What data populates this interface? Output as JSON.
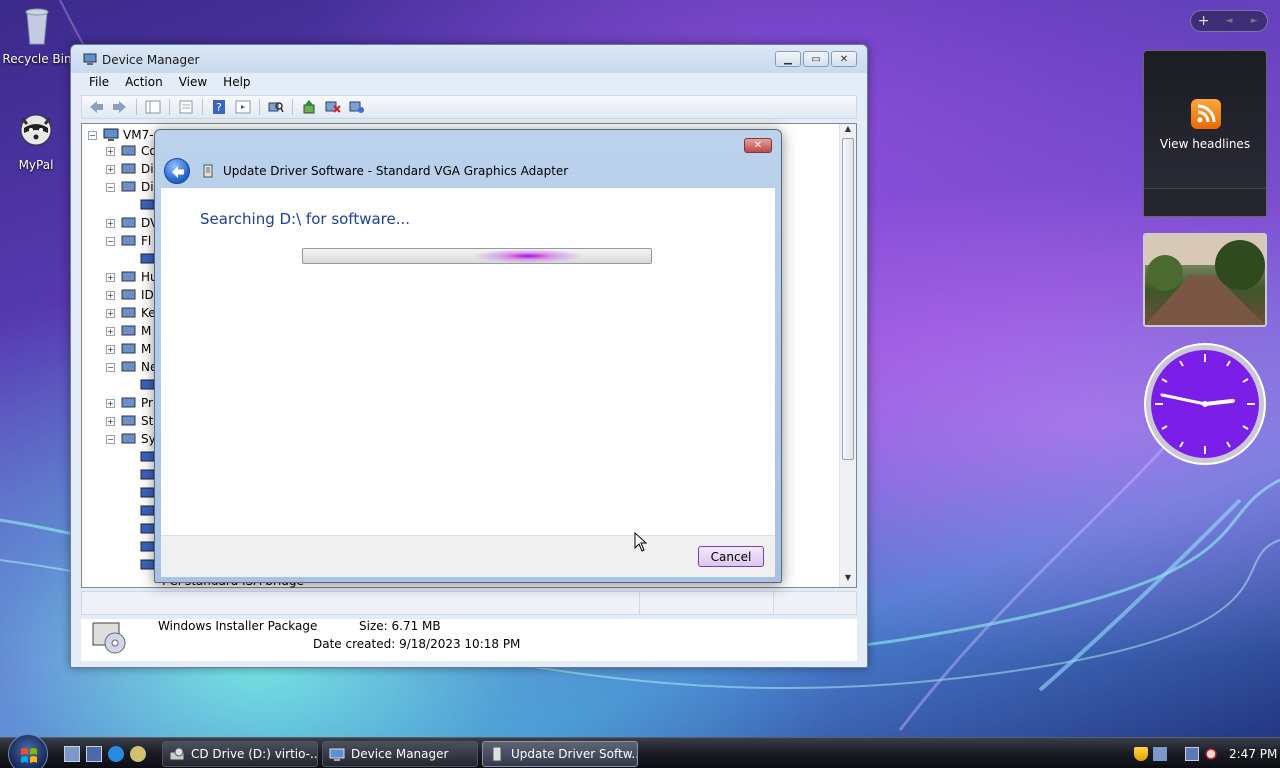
{
  "desktop": {
    "icons": [
      {
        "label": "Recycle Bin",
        "icon": "recycle-bin-icon"
      },
      {
        "label": "MyPal",
        "icon": "mypal-raccoon-icon"
      }
    ]
  },
  "gadgets": {
    "news_label": "View headlines",
    "sidebar_controls": [
      "+",
      "◄",
      "►"
    ],
    "clock": {
      "hour": 2,
      "minute": 47
    }
  },
  "device_manager": {
    "title": "Device Manager",
    "menu": [
      "File",
      "Action",
      "View",
      "Help"
    ],
    "tree_root": "VM7-",
    "tree_items": [
      "Co",
      "Di",
      "Di",
      "DV",
      "Fl",
      "Hu",
      "ID",
      "Ke",
      "M",
      "M",
      "Ne",
      "Pr",
      "St",
      "Sy"
    ],
    "tree_bottom_item": "PCI standard ISA bridge",
    "details": {
      "type": "Windows Installer Package",
      "size_label": "Size:",
      "size_value": "6.71 MB",
      "date_label": "Date created:",
      "date_value": "9/18/2023 10:18 PM"
    }
  },
  "dialog": {
    "title": "Update Driver Software - Standard VGA Graphics Adapter",
    "message": "Searching D:\\ for software...",
    "cancel_label": "Cancel",
    "close_glyph": "✕"
  },
  "taskbar": {
    "buttons": [
      {
        "label": "CD Drive (D:) virtio-...",
        "icon": "cd-drive-icon"
      },
      {
        "label": "Device Manager",
        "icon": "device-manager-icon"
      },
      {
        "label": "Update Driver Softw...",
        "icon": "driver-icon"
      }
    ],
    "clock": "2:47 PM"
  },
  "colors": {
    "dialog_message": "#1c3f94",
    "progress_glow": "#aa00dc",
    "clock_face": "#7a1ee8"
  }
}
